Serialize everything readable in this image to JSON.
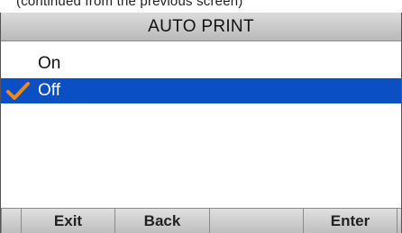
{
  "caption": "(continued from the previous screen)",
  "screen": {
    "title": "AUTO PRINT",
    "options": [
      {
        "label": "On",
        "selected": false
      },
      {
        "label": "Off",
        "selected": true
      }
    ],
    "check_icon": "checkmark-icon",
    "colors": {
      "selection": "#0a4fc4",
      "checkmark": "#f08a12"
    }
  },
  "softkeys": {
    "key1": "Exit",
    "key2": "Back",
    "key3": "",
    "key4": "Enter"
  }
}
